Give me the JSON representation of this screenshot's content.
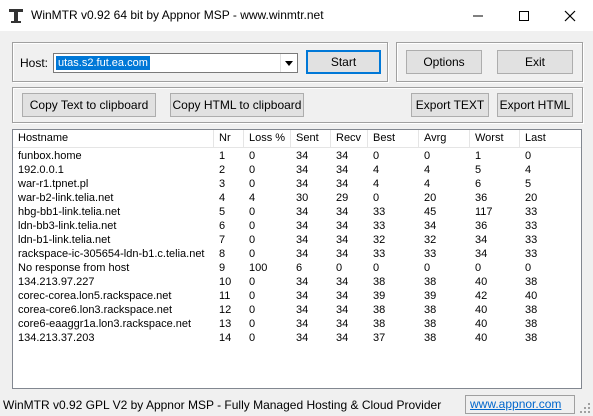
{
  "window": {
    "title": "WinMTR v0.92 64 bit by Appnor MSP - www.winmtr.net"
  },
  "host": {
    "label": "Host:",
    "value": "utas.s2.fut.ea.com"
  },
  "buttons": {
    "start": "Start",
    "options": "Options",
    "exit": "Exit",
    "copy_text": "Copy Text to clipboard",
    "copy_html": "Copy HTML to clipboard",
    "export_text": "Export TEXT",
    "export_html": "Export HTML"
  },
  "table": {
    "columns": [
      "Hostname",
      "Nr",
      "Loss %",
      "Sent",
      "Recv",
      "Best",
      "Avrg",
      "Worst",
      "Last"
    ],
    "rows": [
      [
        "funbox.home",
        "1",
        "0",
        "34",
        "34",
        "0",
        "0",
        "1",
        "0"
      ],
      [
        "192.0.0.1",
        "2",
        "0",
        "34",
        "34",
        "4",
        "4",
        "5",
        "4"
      ],
      [
        "war-r1.tpnet.pl",
        "3",
        "0",
        "34",
        "34",
        "4",
        "4",
        "6",
        "5"
      ],
      [
        "war-b2-link.telia.net",
        "4",
        "4",
        "30",
        "29",
        "0",
        "20",
        "36",
        "20"
      ],
      [
        "hbg-bb1-link.telia.net",
        "5",
        "0",
        "34",
        "34",
        "33",
        "45",
        "117",
        "33"
      ],
      [
        "ldn-bb3-link.telia.net",
        "6",
        "0",
        "34",
        "34",
        "33",
        "34",
        "36",
        "33"
      ],
      [
        "ldn-b1-link.telia.net",
        "7",
        "0",
        "34",
        "34",
        "32",
        "32",
        "34",
        "33"
      ],
      [
        "rackspace-ic-305654-ldn-b1.c.telia.net",
        "8",
        "0",
        "34",
        "34",
        "33",
        "33",
        "34",
        "33"
      ],
      [
        "No response from host",
        "9",
        "100",
        "6",
        "0",
        "0",
        "0",
        "0",
        "0"
      ],
      [
        "134.213.97.227",
        "10",
        "0",
        "34",
        "34",
        "38",
        "38",
        "40",
        "38"
      ],
      [
        "corec-corea.lon5.rackspace.net",
        "11",
        "0",
        "34",
        "34",
        "39",
        "39",
        "42",
        "40"
      ],
      [
        "corea-core6.lon3.rackspace.net",
        "12",
        "0",
        "34",
        "34",
        "38",
        "38",
        "40",
        "38"
      ],
      [
        "core6-eaaggr1a.lon3.rackspace.net",
        "13",
        "0",
        "34",
        "34",
        "38",
        "38",
        "40",
        "38"
      ],
      [
        "134.213.37.203",
        "14",
        "0",
        "34",
        "34",
        "37",
        "38",
        "40",
        "38"
      ]
    ]
  },
  "status": {
    "text": "WinMTR v0.92 GPL V2 by Appnor MSP - Fully Managed Hosting & Cloud Provider",
    "link": "www.appnor.com"
  }
}
